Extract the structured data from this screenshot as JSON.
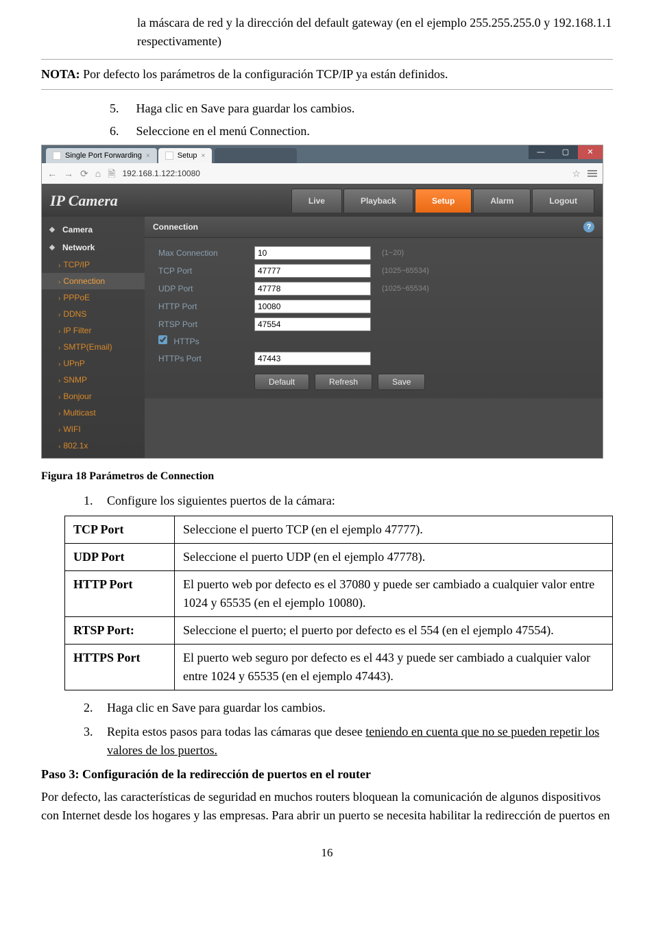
{
  "intro_para": "la máscara de red y la dirección del default gateway (en el ejemplo 255.255.255.0 y 192.168.1.1 respectivamente)",
  "nota_label": "NOTA:",
  "nota_text": " Por defecto los parámetros de la configuración TCP/IP ya están definidos.",
  "list_pre": {
    "n5": "5.",
    "t5": "Haga clic en Save para guardar los cambios.",
    "n6": "6.",
    "t6": "Seleccione en el menú Connection."
  },
  "browser": {
    "tab1": "Single Port Forwarding",
    "tab2": "Setup",
    "addr": "192.168.1.122:10080"
  },
  "ipc": {
    "title_ip": "IP",
    "title_rest": " Camera",
    "nav": {
      "live": "Live",
      "playback": "Playback",
      "setup": "Setup",
      "alarm": "Alarm",
      "logout": "Logout"
    },
    "side": {
      "camera": "Camera",
      "network": "Network",
      "tcpip": "TCP/IP",
      "connection": "Connection",
      "pppoe": "PPPoE",
      "ddns": "DDNS",
      "ipfilter": "IP Filter",
      "smtp": "SMTP(Email)",
      "upnp": "UPnP",
      "snmp": "SNMP",
      "bonjour": "Bonjour",
      "multicast": "Multicast",
      "wifi": "WIFI",
      "_8021x": "802.1x"
    },
    "section": "Connection",
    "form": {
      "maxconn_l": "Max Connection",
      "maxconn_v": "10",
      "maxconn_h": "(1~20)",
      "tcp_l": "TCP Port",
      "tcp_v": "47777",
      "tcp_h": "(1025~65534)",
      "udp_l": "UDP Port",
      "udp_v": "47778",
      "udp_h": "(1025~65534)",
      "http_l": "HTTP Port",
      "http_v": "10080",
      "rtsp_l": "RTSP Port",
      "rtsp_v": "47554",
      "https_chk": "HTTPs",
      "https_l": "HTTPs Port",
      "https_v": "47443",
      "btn_default": "Default",
      "btn_refresh": "Refresh",
      "btn_save": "Save"
    }
  },
  "fig_caption": "Figura 18 Parámetros de Connection",
  "list_cfg": {
    "n1": "1.",
    "t1": "Configure los siguientes puertos de la cámara:"
  },
  "table": {
    "tcp_l": "TCP Port",
    "tcp_d": "Seleccione el puerto TCP (en el ejemplo 47777).",
    "udp_l": "UDP Port",
    "udp_d": "Seleccione el puerto UDP (en el ejemplo 47778).",
    "http_l": "HTTP Port",
    "http_d": "El puerto web por defecto es el 37080 y puede ser cambiado a cualquier valor entre 1024 y 65535 (en el ejemplo 10080).",
    "rtsp_l": "RTSP Port:",
    "rtsp_d": "Seleccione el puerto; el puerto por defecto es el 554 (en el ejemplo 47554).",
    "https_l": "HTTPS Port",
    "https_d": "El puerto web seguro por defecto es el 443 y puede ser cambiado a cualquier valor entre 1024 y 65535 (en el ejemplo 47443)."
  },
  "list_post": {
    "n2": "2.",
    "t2": "Haga clic en Save para guardar los cambios.",
    "n3": "3.",
    "t3a": "Repita estos pasos para todas las cámaras que desee ",
    "t3b": "teniendo en cuenta que no se pueden repetir los valores de los puertos."
  },
  "step3_head": "Paso 3: Configuración de la redirección de puertos en el router",
  "step3_body": "Por defecto, las características de seguridad en muchos routers bloquean la comunicación de algunos dispositivos con Internet desde los hogares y las empresas. Para abrir un puerto se necesita habilitar la redirección de puertos en",
  "page_num": "16"
}
